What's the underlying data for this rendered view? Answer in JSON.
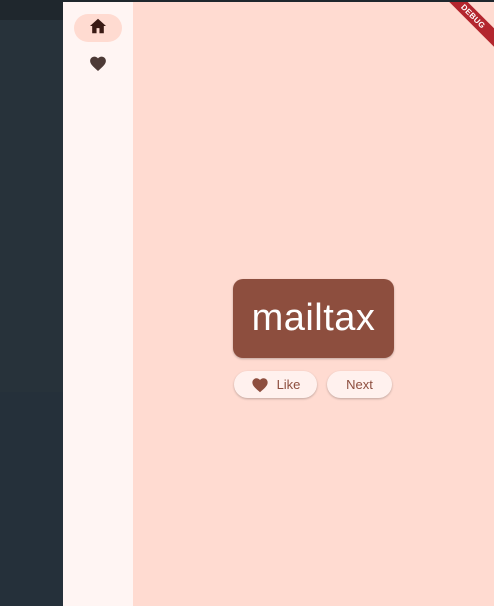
{
  "nav": {
    "items": [
      {
        "icon": "home-icon",
        "selected": true
      },
      {
        "icon": "heart-icon",
        "selected": false
      }
    ]
  },
  "card": {
    "word": "mailtax"
  },
  "actions": {
    "like_label": "Like",
    "next_label": "Next"
  },
  "debug_banner": "DEBUG",
  "colors": {
    "accent": "#8d4e3e",
    "background": "#ffdbd1",
    "rail": "#fff5f3",
    "banner": "#b3262e"
  }
}
